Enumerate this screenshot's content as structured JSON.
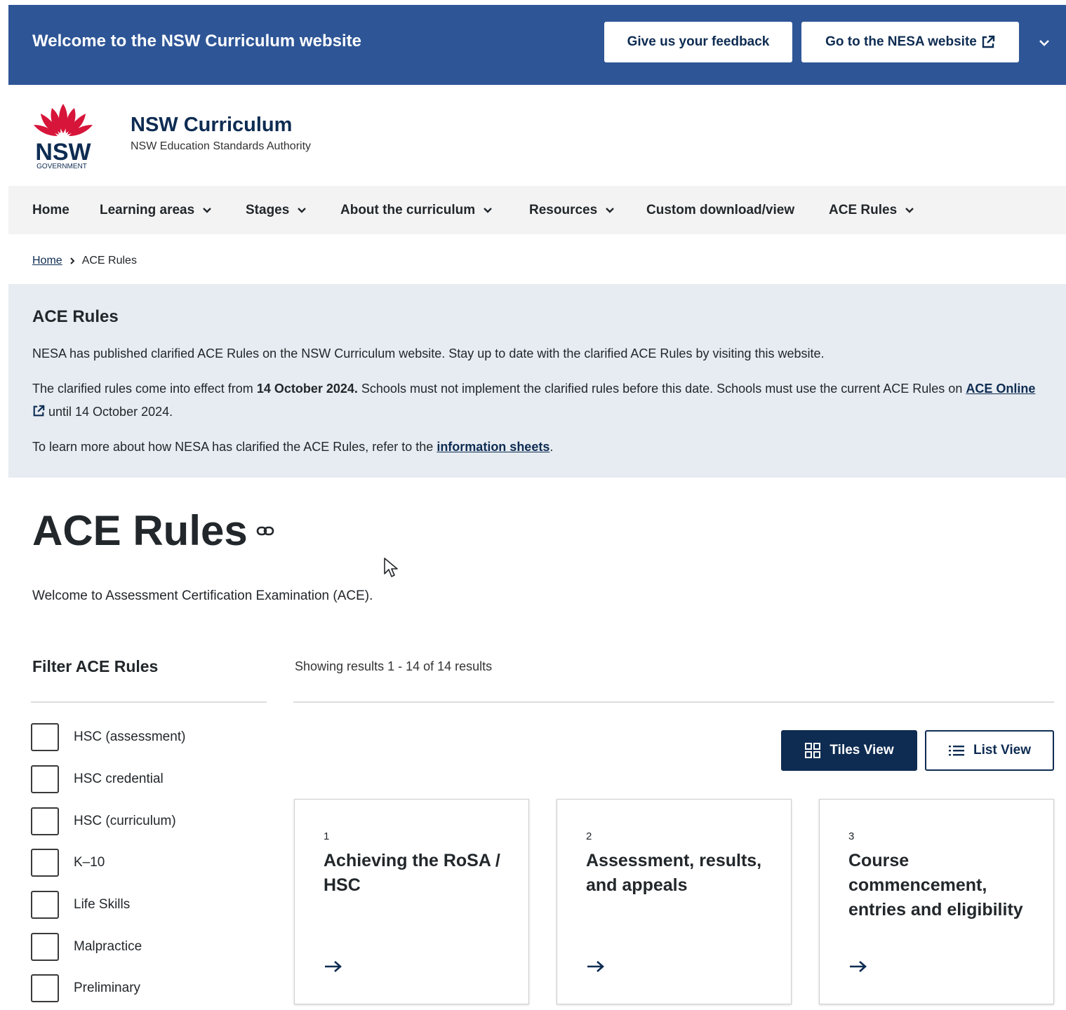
{
  "topbar": {
    "welcome": "Welcome to the NSW Curriculum website",
    "feedback_label": "Give us your feedback",
    "nesa_label": "Go to the NESA website"
  },
  "brand": {
    "logo_text": "NSW",
    "logo_subtext": "GOVERNMENT",
    "site_title": "NSW Curriculum",
    "site_subtitle": "NSW Education Standards Authority"
  },
  "nav": {
    "items": [
      {
        "label": "Home",
        "dropdown": false
      },
      {
        "label": "Learning areas",
        "dropdown": true
      },
      {
        "label": "Stages",
        "dropdown": true
      },
      {
        "label": "About the curriculum",
        "dropdown": true
      },
      {
        "label": "Resources",
        "dropdown": true
      },
      {
        "label": "Custom download/view",
        "dropdown": false
      },
      {
        "label": "ACE Rules",
        "dropdown": true
      }
    ]
  },
  "breadcrumb": {
    "home": "Home",
    "current": "ACE Rules"
  },
  "notice": {
    "heading": "ACE Rules",
    "p1": "NESA has published clarified ACE Rules on the NSW Curriculum website. Stay up to date with the clarified ACE Rules by visiting this website.",
    "p2_pre": "The clarified rules come into effect from ",
    "p2_bold": "14 October 2024.",
    "p2_post": " Schools must not implement the clarified rules before this date. Schools must use the current ACE Rules on ",
    "p2_link": "ACE Online",
    "p2_end": " until 14 October 2024.",
    "p3_pre": "To learn more about how NESA has clarified the ACE Rules, refer to the ",
    "p3_link": "information sheets",
    "p3_end": "."
  },
  "page": {
    "title": "ACE Rules",
    "intro": "Welcome to Assessment Certification Examination (ACE)."
  },
  "filter": {
    "title": "Filter ACE Rules",
    "options": [
      "HSC (assessment)",
      "HSC credential",
      "HSC (curriculum)",
      "K–10",
      "Life Skills",
      "Malpractice",
      "Preliminary"
    ]
  },
  "results": {
    "prefix": "Showing results ",
    "range": "1 - 14",
    "of": " of ",
    "total": "14",
    "suffix": " results"
  },
  "views": {
    "tiles": "Tiles View",
    "list": "List View"
  },
  "cards": [
    {
      "num": "1",
      "title": "Achieving the RoSA / HSC"
    },
    {
      "num": "2",
      "title": "Assessment, results, and appeals"
    },
    {
      "num": "3",
      "title": "Course commencement, entries and eligibility"
    }
  ],
  "colors": {
    "topbar": "#2e5596",
    "navy": "#0e2c52",
    "notice_bg": "#e7ecf2",
    "logo_red": "#d7153a"
  }
}
